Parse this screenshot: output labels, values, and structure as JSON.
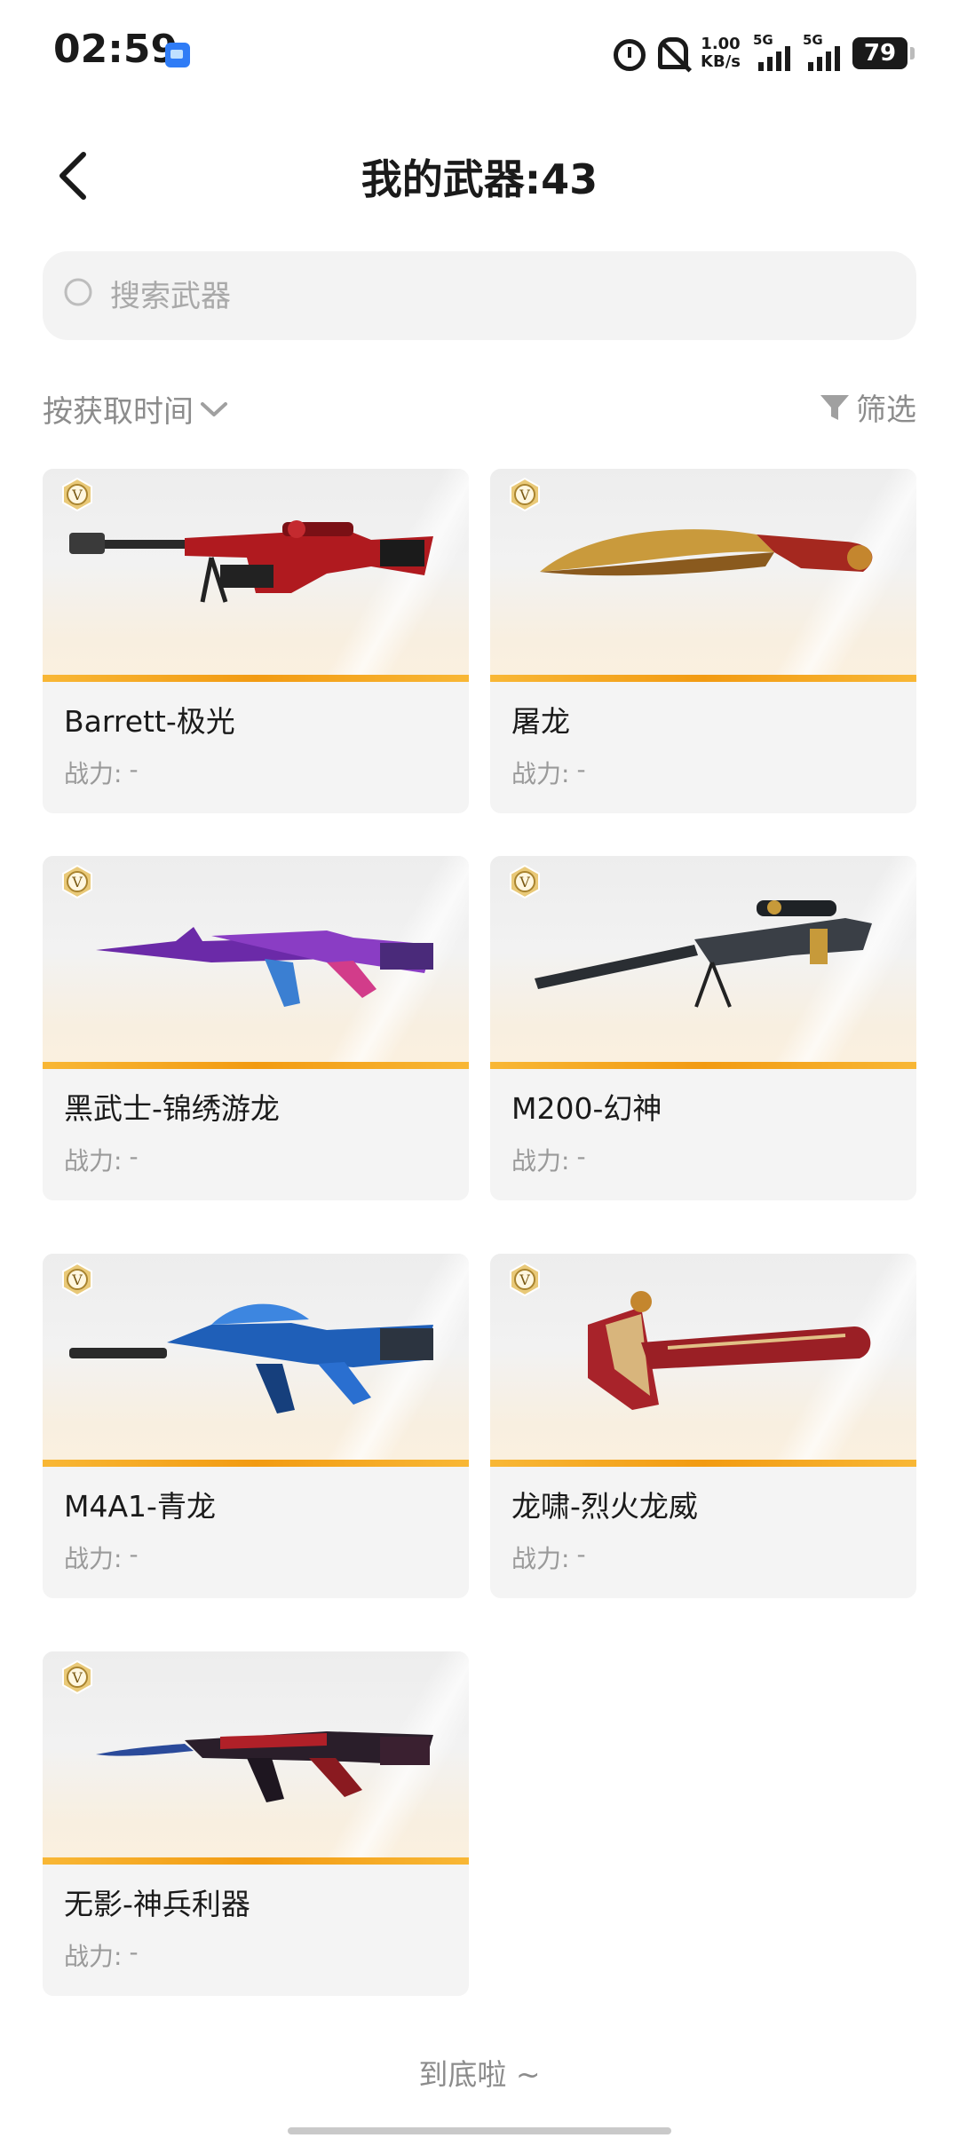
{
  "status_bar": {
    "time": "02:59",
    "net_speed_value": "1.00",
    "net_speed_unit": "KB/s",
    "sim1_label": "5G",
    "sim2_label": "5G",
    "battery": "79"
  },
  "header": {
    "title": "我的武器:43"
  },
  "search": {
    "placeholder": "搜索武器",
    "value": ""
  },
  "toolbar": {
    "sort_label": "按获取时间",
    "filter_label": "筛选"
  },
  "power_label": "战力:",
  "weapons": [
    {
      "name": "Barrett-极光",
      "power": "-",
      "icon": "sniper-rifle-red"
    },
    {
      "name": "屠龙",
      "power": "-",
      "icon": "kukri-blade-gold"
    },
    {
      "name": "黑武士-锦绣游龙",
      "power": "-",
      "icon": "assault-rifle-purple"
    },
    {
      "name": "M200-幻神",
      "power": "-",
      "icon": "sniper-rifle-dark"
    },
    {
      "name": "M4A1-青龙",
      "power": "-",
      "icon": "assault-rifle-blue"
    },
    {
      "name": "龙啸-烈火龙威",
      "power": "-",
      "icon": "axe-red"
    },
    {
      "name": "无影-神兵利器",
      "power": "-",
      "icon": "assault-rifle-red-dark"
    }
  ],
  "footer": {
    "end_text": "到底啦 ~"
  },
  "colors": {
    "accent_stripe": "#f29b12",
    "card_bg": "#f4f4f4",
    "muted_text": "#8c8c8c"
  }
}
